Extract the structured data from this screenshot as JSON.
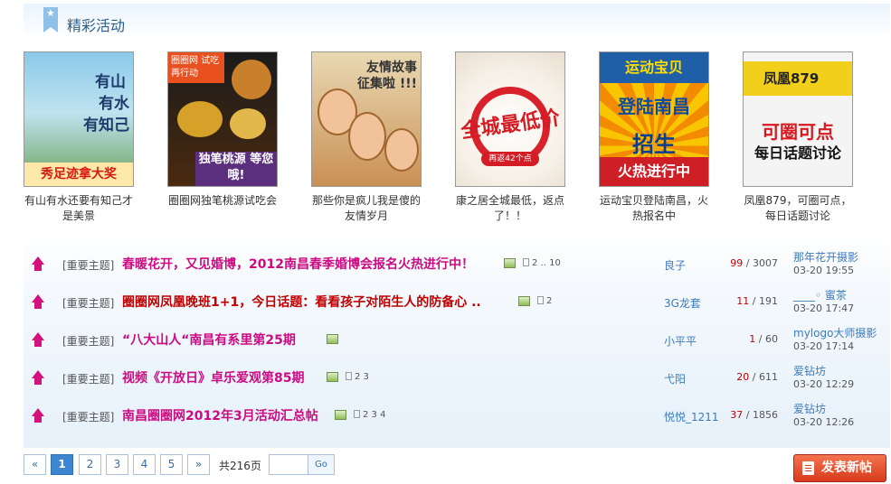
{
  "section": {
    "title": "精彩活动"
  },
  "activities": [
    {
      "caption": "有山有水还要有知己才是美景",
      "poster": {
        "l1": "有山",
        "l2": "有水",
        "l3": "有知己",
        "band": "秀足迹拿大奖"
      }
    },
    {
      "caption": "圈圈网独笔桃源试吃会",
      "poster": {
        "tag": "圈圈网 试吃再行动",
        "strip": "独笔桃源 等您哦!"
      }
    },
    {
      "caption": "那些你是疯儿我是傻的友情岁月",
      "poster": {
        "msg": "友情故事 征集啦 !!!"
      }
    },
    {
      "caption": "康之居全城最低，返点了！！",
      "poster": {
        "big": "全城最低价",
        "pill": "再返42个点"
      }
    },
    {
      "caption": "运动宝贝登陆南昌，火热报名中",
      "poster": {
        "top": "运动宝贝",
        "l1": "登陆南昌",
        "l2": "招生",
        "foot": "火热进行中"
      }
    },
    {
      "caption": "凤凰879，可圈可点，每日话题讨论",
      "poster": {
        "bar": "凤凰879",
        "l1": "可圈可点",
        "l2": "每日话题讨论"
      }
    }
  ],
  "threads": [
    {
      "tag": "[重要主题]",
      "title": "春暖花开，又见婚博，2012南昌春季婚博会报名火热进行中！",
      "title_color": "pink",
      "pages": "2 .. 10",
      "author": "良子",
      "replies": "99",
      "views": "3007",
      "last_user": "那年花开摄影",
      "last_time": "03-20 19:55"
    },
    {
      "tag": "[重要主题]",
      "title": "圈圈网凤凰晚班1+1，今日话题：看看孩子对陌生人的防备心 ..",
      "title_color": "red",
      "pages": "2",
      "author": "3G龙套",
      "replies": "11",
      "views": "191",
      "last_user": "____◦ 蜜茶",
      "last_time": "03-20 17:47"
    },
    {
      "tag": "[重要主题]",
      "title": "“八大山人“南昌有系里第25期",
      "title_color": "pink",
      "pages": "",
      "author": "小平平",
      "replies": "1",
      "views": "60",
      "last_user": "mylogo大师摄影",
      "last_time": "03-20 17:14"
    },
    {
      "tag": "[重要主题]",
      "title": "视频《开放日》卓乐爱观第85期",
      "title_color": "pink",
      "pages": "2 3",
      "author": "弋阳",
      "replies": "20",
      "views": "611",
      "last_user": "爱钻坊",
      "last_time": "03-20 12:29"
    },
    {
      "tag": "[重要主题]",
      "title": "南昌圈圈网2012年3月活动汇总帖",
      "title_color": "pink",
      "pages": "2 3 4",
      "author": "悦悦_1211",
      "replies": "37",
      "views": "1856",
      "last_user": "爱钻坊",
      "last_time": "03-20 12:26"
    }
  ],
  "pager": {
    "prev": "«",
    "pages": [
      "1",
      "2",
      "3",
      "4",
      "5"
    ],
    "current": "1",
    "next": "»",
    "total": "共216页",
    "go": "Go"
  },
  "post_button": "发表新帖",
  "colors": {
    "accent": "#3d85cf",
    "title_pink": "#cc0b82",
    "title_red": "#c00000",
    "post_button": "#d83a1d"
  }
}
